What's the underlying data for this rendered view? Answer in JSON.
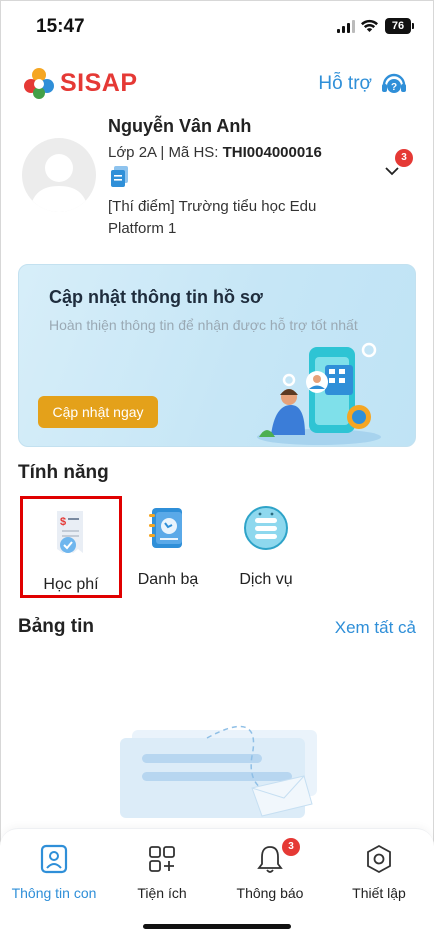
{
  "status_bar": {
    "time": "15:47",
    "battery": "76"
  },
  "header": {
    "brand": "SISAP",
    "help_label": "Hỗ trợ"
  },
  "profile": {
    "name": "Nguyễn Vân Anh",
    "class_prefix": "Lớp 2A | Mã HS: ",
    "student_id": "THI004000016",
    "school": "[Thí điểm] Trường tiểu học Edu Platform 1",
    "notification_count": "3"
  },
  "banner": {
    "title": "Cập nhật thông tin hồ sơ",
    "subtitle": "Hoàn thiện thông tin để nhận được hỗ trợ tốt nhất",
    "button_label": "Cập nhật ngay"
  },
  "features": {
    "title": "Tính năng",
    "items": [
      {
        "label": "Học phí",
        "icon": "tuition-receipt-icon"
      },
      {
        "label": "Danh bạ",
        "icon": "contact-book-icon"
      },
      {
        "label": "Dịch vụ",
        "icon": "service-list-icon"
      }
    ]
  },
  "news": {
    "title": "Bảng tin",
    "see_all": "Xem tất cả"
  },
  "bottom_nav": {
    "items": [
      {
        "label": "Thông tin con",
        "icon": "child-profile-icon",
        "active": true
      },
      {
        "label": "Tiện ích",
        "icon": "utilities-grid-icon"
      },
      {
        "label": "Thông báo",
        "icon": "bell-icon",
        "badge": "3"
      },
      {
        "label": "Thiết lập",
        "icon": "settings-hex-icon"
      }
    ]
  },
  "colors": {
    "brand_red": "#e53935",
    "accent_blue": "#2f8fd8",
    "cta_orange": "#e4a11a",
    "highlight_red": "#e00000"
  }
}
